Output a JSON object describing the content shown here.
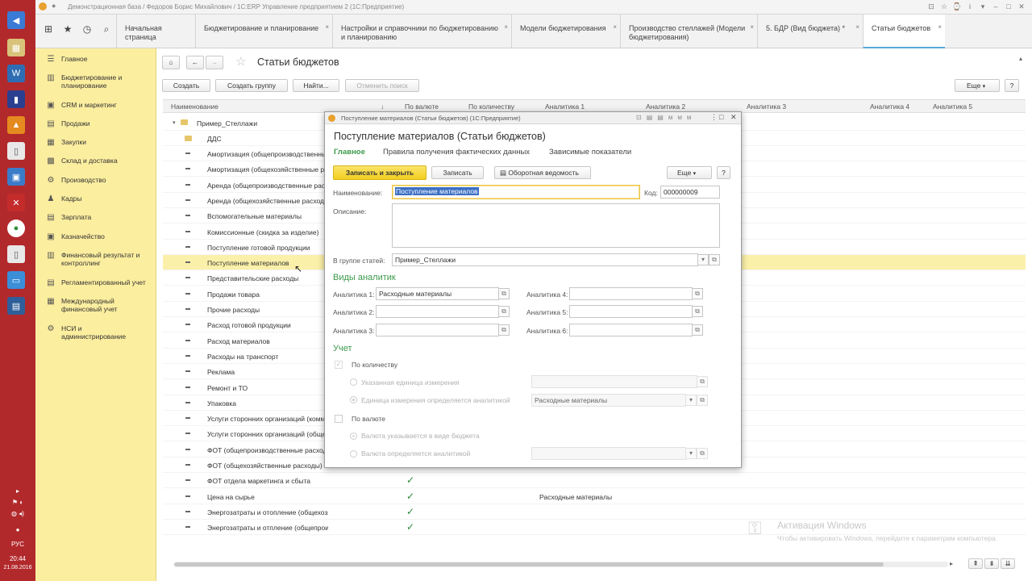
{
  "window": {
    "title": "Демонстрационная база / Федоров Борис Михайлович / 1С:ERP Управление предприятием 2 (1С:Предприятие)"
  },
  "tabs": [
    {
      "label": "Начальная страница"
    },
    {
      "label": "Бюджетирование и планирование"
    },
    {
      "label": "Настройки и справочники по бюджетированию и планированию"
    },
    {
      "label": "Модели бюджетирования"
    },
    {
      "label": "Производство стеллажей (Модели бюджетирования)"
    },
    {
      "label": "5. БДР (Вид бюджета) *"
    },
    {
      "label": "Статьи бюджетов"
    }
  ],
  "sidebar": {
    "items": [
      {
        "label": "Главное"
      },
      {
        "label": "Бюджетирование и планирование"
      },
      {
        "label": "CRM и маркетинг"
      },
      {
        "label": "Продажи"
      },
      {
        "label": "Закупки"
      },
      {
        "label": "Склад и доставка"
      },
      {
        "label": "Производство"
      },
      {
        "label": "Кадры"
      },
      {
        "label": "Зарплата"
      },
      {
        "label": "Казначейство"
      },
      {
        "label": "Финансовый результат и контроллинг"
      },
      {
        "label": "Регламентированный учет"
      },
      {
        "label": "Международный финансовый учет"
      },
      {
        "label": "НСИ и администрирование"
      }
    ]
  },
  "page": {
    "title": "Статьи бюджетов",
    "toolbar": {
      "create": "Создать",
      "create_group": "Создать группу",
      "find": "Найти...",
      "cancel_search": "Отменить поиск",
      "more": "Еще"
    }
  },
  "table": {
    "columns": [
      "Наименование",
      "По валюте",
      "По количеству",
      "Аналитика 1",
      "Аналитика 2",
      "Аналитика 3",
      "Аналитика 4",
      "Аналитика 5"
    ],
    "groups": [
      {
        "name": "Пример_Стеллажи"
      },
      {
        "name": "ДДС"
      }
    ],
    "rows": [
      {
        "name": "Амортизация (общепроизводственные расходы)"
      },
      {
        "name": "Амортизация (общехозяйственные расходы)"
      },
      {
        "name": "Аренда (общепроизводственные расходы)"
      },
      {
        "name": "Аренда (общехозяйственные расходы)"
      },
      {
        "name": "Вспомогательные материалы"
      },
      {
        "name": "Комиссионные (скидка за изделие)"
      },
      {
        "name": "Поступление готовой продукции"
      },
      {
        "name": "Поступление материалов",
        "selected": true
      },
      {
        "name": "Представительские расходы"
      },
      {
        "name": "Продажи товара"
      },
      {
        "name": "Прочие расходы"
      },
      {
        "name": "Расход готовой продукции"
      },
      {
        "name": "Расход материалов"
      },
      {
        "name": "Расходы на транспорт"
      },
      {
        "name": "Реклама"
      },
      {
        "name": "Ремонт и ТО"
      },
      {
        "name": "Упаковка"
      },
      {
        "name": "Услуги сторонних организаций (коммерческие расходы)"
      },
      {
        "name": "Услуги сторонних организаций (общехозяйственные расходы)"
      },
      {
        "name": "ФОТ (общепроизводственные расходы)"
      },
      {
        "name": "ФОТ (общехозяйственные расходы)"
      },
      {
        "name": "ФОТ отдела маркетинга и сбыта",
        "by_currency": true
      },
      {
        "name": "Цена на сырье",
        "by_currency": true,
        "analytics1": "Расходные материалы"
      },
      {
        "name": "Энергозатраты и отопление (общехозяйственные расходы)",
        "by_currency": true
      },
      {
        "name": "Энергозатраты и отпление (общепроизводственные расходы)",
        "by_currency": true
      }
    ]
  },
  "dialog": {
    "titlebar": "Поступление материалов (Статьи бюджетов) (1С:Предприятие)",
    "heading": "Поступление материалов (Статьи бюджетов)",
    "nav": [
      "Главное",
      "Правила получения фактических данных",
      "Зависимые показатели"
    ],
    "buttons": {
      "save_close": "Записать и закрыть",
      "save": "Записать",
      "report": "Оборотная ведомость",
      "more": "Еще",
      "help": "?"
    },
    "name_label": "Наименование:",
    "name_value": "Поступление материалов",
    "code_label": "Код:",
    "code_value": "000000009",
    "desc_label": "Описание:",
    "group_label": "В группе статей:",
    "group_value": "Пример_Стеллажи",
    "analytics_section": "Виды аналитик",
    "analytics": [
      {
        "label": "Аналитика 1:",
        "value": "Расходные материалы"
      },
      {
        "label": "Аналитика 2:",
        "value": ""
      },
      {
        "label": "Аналитика 3:",
        "value": ""
      },
      {
        "label": "Аналитика 4:",
        "value": ""
      },
      {
        "label": "Аналитика 5:",
        "value": ""
      },
      {
        "label": "Аналитика 6:",
        "value": ""
      }
    ],
    "accounting_section": "Учет",
    "by_quantity": "По количеству",
    "unit_specified": "Указанная единица измерения",
    "unit_by_analytics": "Единица измерения определяется аналитикой",
    "unit_analytics_value": "Расходные материалы",
    "by_currency": "По валюте",
    "currency_in_budget": "Валюта указывается в виде бюджета",
    "currency_by_analytics": "Валюта определяется аналитикой"
  },
  "status": {
    "lang": "РУС",
    "time": "20:44",
    "date": "21.08.2016"
  },
  "watermark": {
    "title": "Активация Windows",
    "text": "Чтобы активировать Windows, перейдите к параметрам компьютера."
  },
  "colors": {
    "accent_yellow": "#fcee9f",
    "button_yellow": "#f8d930",
    "green": "#3a9a4a",
    "taskbar": "#b2292c"
  }
}
